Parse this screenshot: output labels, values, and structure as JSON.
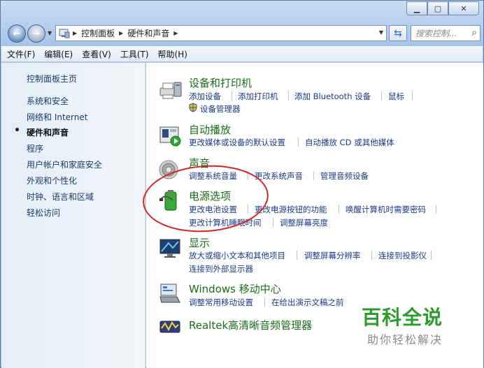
{
  "address": {
    "crumbs": [
      "控制面板",
      "硬件和声音"
    ]
  },
  "search": {
    "placeholder": "搜索控制..."
  },
  "menubar": [
    "文件(F)",
    "编辑(E)",
    "查看(V)",
    "工具(T)",
    "帮助(H)"
  ],
  "sidebar": {
    "home": "控制面板主页",
    "items": [
      "系统和安全",
      "网络和 Internet",
      "硬件和声音",
      "程序",
      "用户帐户和家庭安全",
      "外观和个性化",
      "时钟、语言和区域",
      "轻松访问"
    ],
    "active_index": 2
  },
  "categories": [
    {
      "title": "设备和打印机",
      "icon": "printer-icon",
      "links": [
        "添加设备",
        "添加打印机",
        "添加 Bluetooth 设备",
        "鼠标"
      ],
      "links2": [
        "设备管理器"
      ]
    },
    {
      "title": "自动播放",
      "icon": "autoplay-icon",
      "links": [
        "更改媒体或设备的默认设置",
        "自动播放 CD 或其他媒体"
      ]
    },
    {
      "title": "声音",
      "icon": "speaker-icon",
      "links": [
        "调整系统音量",
        "更改系统声音",
        "管理音频设备"
      ]
    },
    {
      "title": "电源选项",
      "icon": "battery-icon",
      "links": [
        "更改电池设置",
        "更改电源按钮的功能",
        "唤醒计算机时需要密码"
      ],
      "links2": [
        "更改计算机睡眠时间",
        "调整屏幕亮度"
      ]
    },
    {
      "title": "显示",
      "icon": "monitor-icon",
      "links": [
        "放大或缩小文本和其他项目",
        "调整屏幕分辨率",
        "连接到投影仪"
      ],
      "links2": [
        "连接到外部显示器"
      ]
    },
    {
      "title": "Windows 移动中心",
      "icon": "mobility-center-icon",
      "links": [
        "调整常用移动设置",
        "在给出演示文稿之前"
      ]
    },
    {
      "title": "Realtek高清晰音频管理器",
      "icon": "realtek-audio-icon",
      "links": []
    }
  ],
  "watermark": {
    "title": "百科全说",
    "subtitle": "助你轻松解决"
  },
  "colors": {
    "category_title": "#1c6d1c",
    "link": "#1c3a8b",
    "highlight_circle": "#d02424"
  }
}
